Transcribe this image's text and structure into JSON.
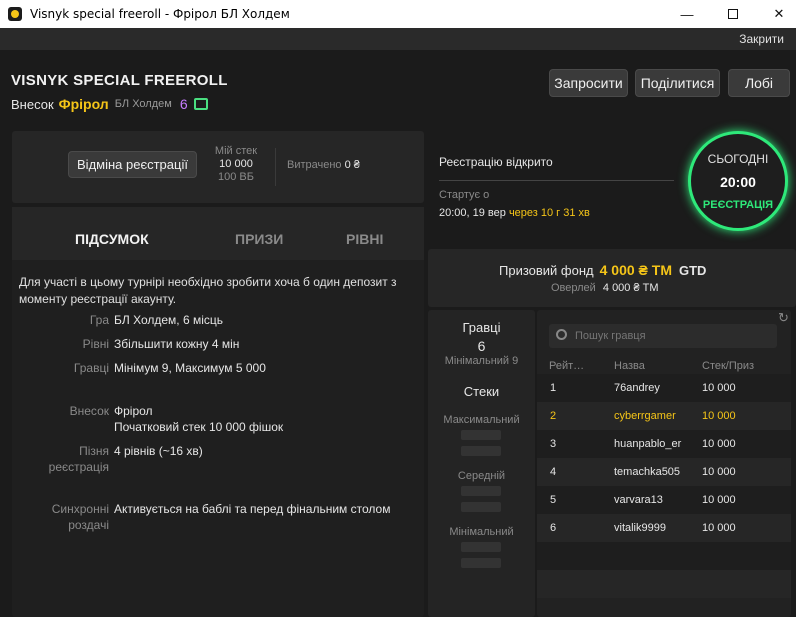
{
  "window": {
    "title": "Visnyk special freeroll  - Фрірол БЛ Холдем"
  },
  "menubar": {
    "close_label": "Закрити"
  },
  "header": {
    "title": "VISNYK SPECIAL FREEROLL",
    "buyin_label": "Внесок",
    "buyin_value": "Фрірол",
    "game": "БЛ Холдем",
    "count": "6"
  },
  "actions": {
    "invite": "Запросити",
    "share": "Поділитися",
    "lobby": "Лобі"
  },
  "registration": {
    "cancel_button": "Відміна реєстрації",
    "my_stack_label": "Мій стек",
    "my_stack_chips": "10 000",
    "my_stack_bb": "100 ВБ",
    "spent_label": "Витрачено",
    "spent_value": "0 ₴"
  },
  "status": {
    "reg_open": "Реєстрацію відкрито",
    "starts_label": "Стартує о",
    "start_time": "20:00, 19 вер",
    "countdown": "через 10 г 31 хв",
    "ring_day": "СЬОГОДНІ",
    "ring_time": "20:00",
    "ring_state": "РЕЄСТРАЦІЯ"
  },
  "tabs": [
    {
      "label": "ПІДСУМОК",
      "active": true
    },
    {
      "label": "ПРИЗИ",
      "active": false
    },
    {
      "label": "РІВНІ",
      "active": false
    }
  ],
  "summary": {
    "note": "Для участі в цьому турнірі необхідно зробити хоча б один депозит з моменту реєстрації акаунту.",
    "rows": [
      {
        "key": "Гра",
        "value": "БЛ Холдем, 6 місць"
      },
      {
        "key": "Рівні",
        "value": "Збільшити кожну 4 мін"
      },
      {
        "key": "Гравці",
        "value": "Мінімум 9, Максимум 5 000"
      },
      {
        "key": "Внесок",
        "value": "Фрірол",
        "value2": "Початковий стек 10 000 фішок"
      },
      {
        "key": "Пізня",
        "key2": "реєстрація",
        "value": "4 рівнів (~16 хв)"
      },
      {
        "key": "Синхронні",
        "key2": "роздачі",
        "value": "Активується на баблі та перед фінальним столом"
      }
    ]
  },
  "prize": {
    "label": "Призовий фонд",
    "amount": "4 000 ₴ ТМ",
    "gtd": "GTD",
    "overlay_label": "Оверлей",
    "overlay_value": "4 000 ₴ ТМ"
  },
  "players_stats": {
    "players_label": "Гравці",
    "players_count": "6",
    "min_label": "Мінімальний 9",
    "stacks_label": "Стеки",
    "max_label": "Максимальний",
    "avg_label": "Середній",
    "min_stack_label": "Мінімальний"
  },
  "player_list": {
    "search_placeholder": "Пошук гравця",
    "columns": [
      "Рейт…",
      "Назва",
      "Стек/Приз"
    ],
    "rows": [
      {
        "rank": "1",
        "name": "76andrey",
        "stack": "10 000",
        "highlight": false
      },
      {
        "rank": "2",
        "name": "cyberrgamer",
        "stack": "10 000",
        "highlight": true
      },
      {
        "rank": "3",
        "name": "huanpablo_er",
        "stack": "10 000",
        "highlight": false
      },
      {
        "rank": "4",
        "name": "temachka505",
        "stack": "10 000",
        "highlight": false
      },
      {
        "rank": "5",
        "name": "varvara13",
        "stack": "10 000",
        "highlight": false
      },
      {
        "rank": "6",
        "name": "vitalik9999",
        "stack": "10 000",
        "highlight": false
      }
    ]
  },
  "colors": {
    "accent": "#f5c518",
    "ring": "#2ee97a",
    "purple": "#c77dff"
  }
}
